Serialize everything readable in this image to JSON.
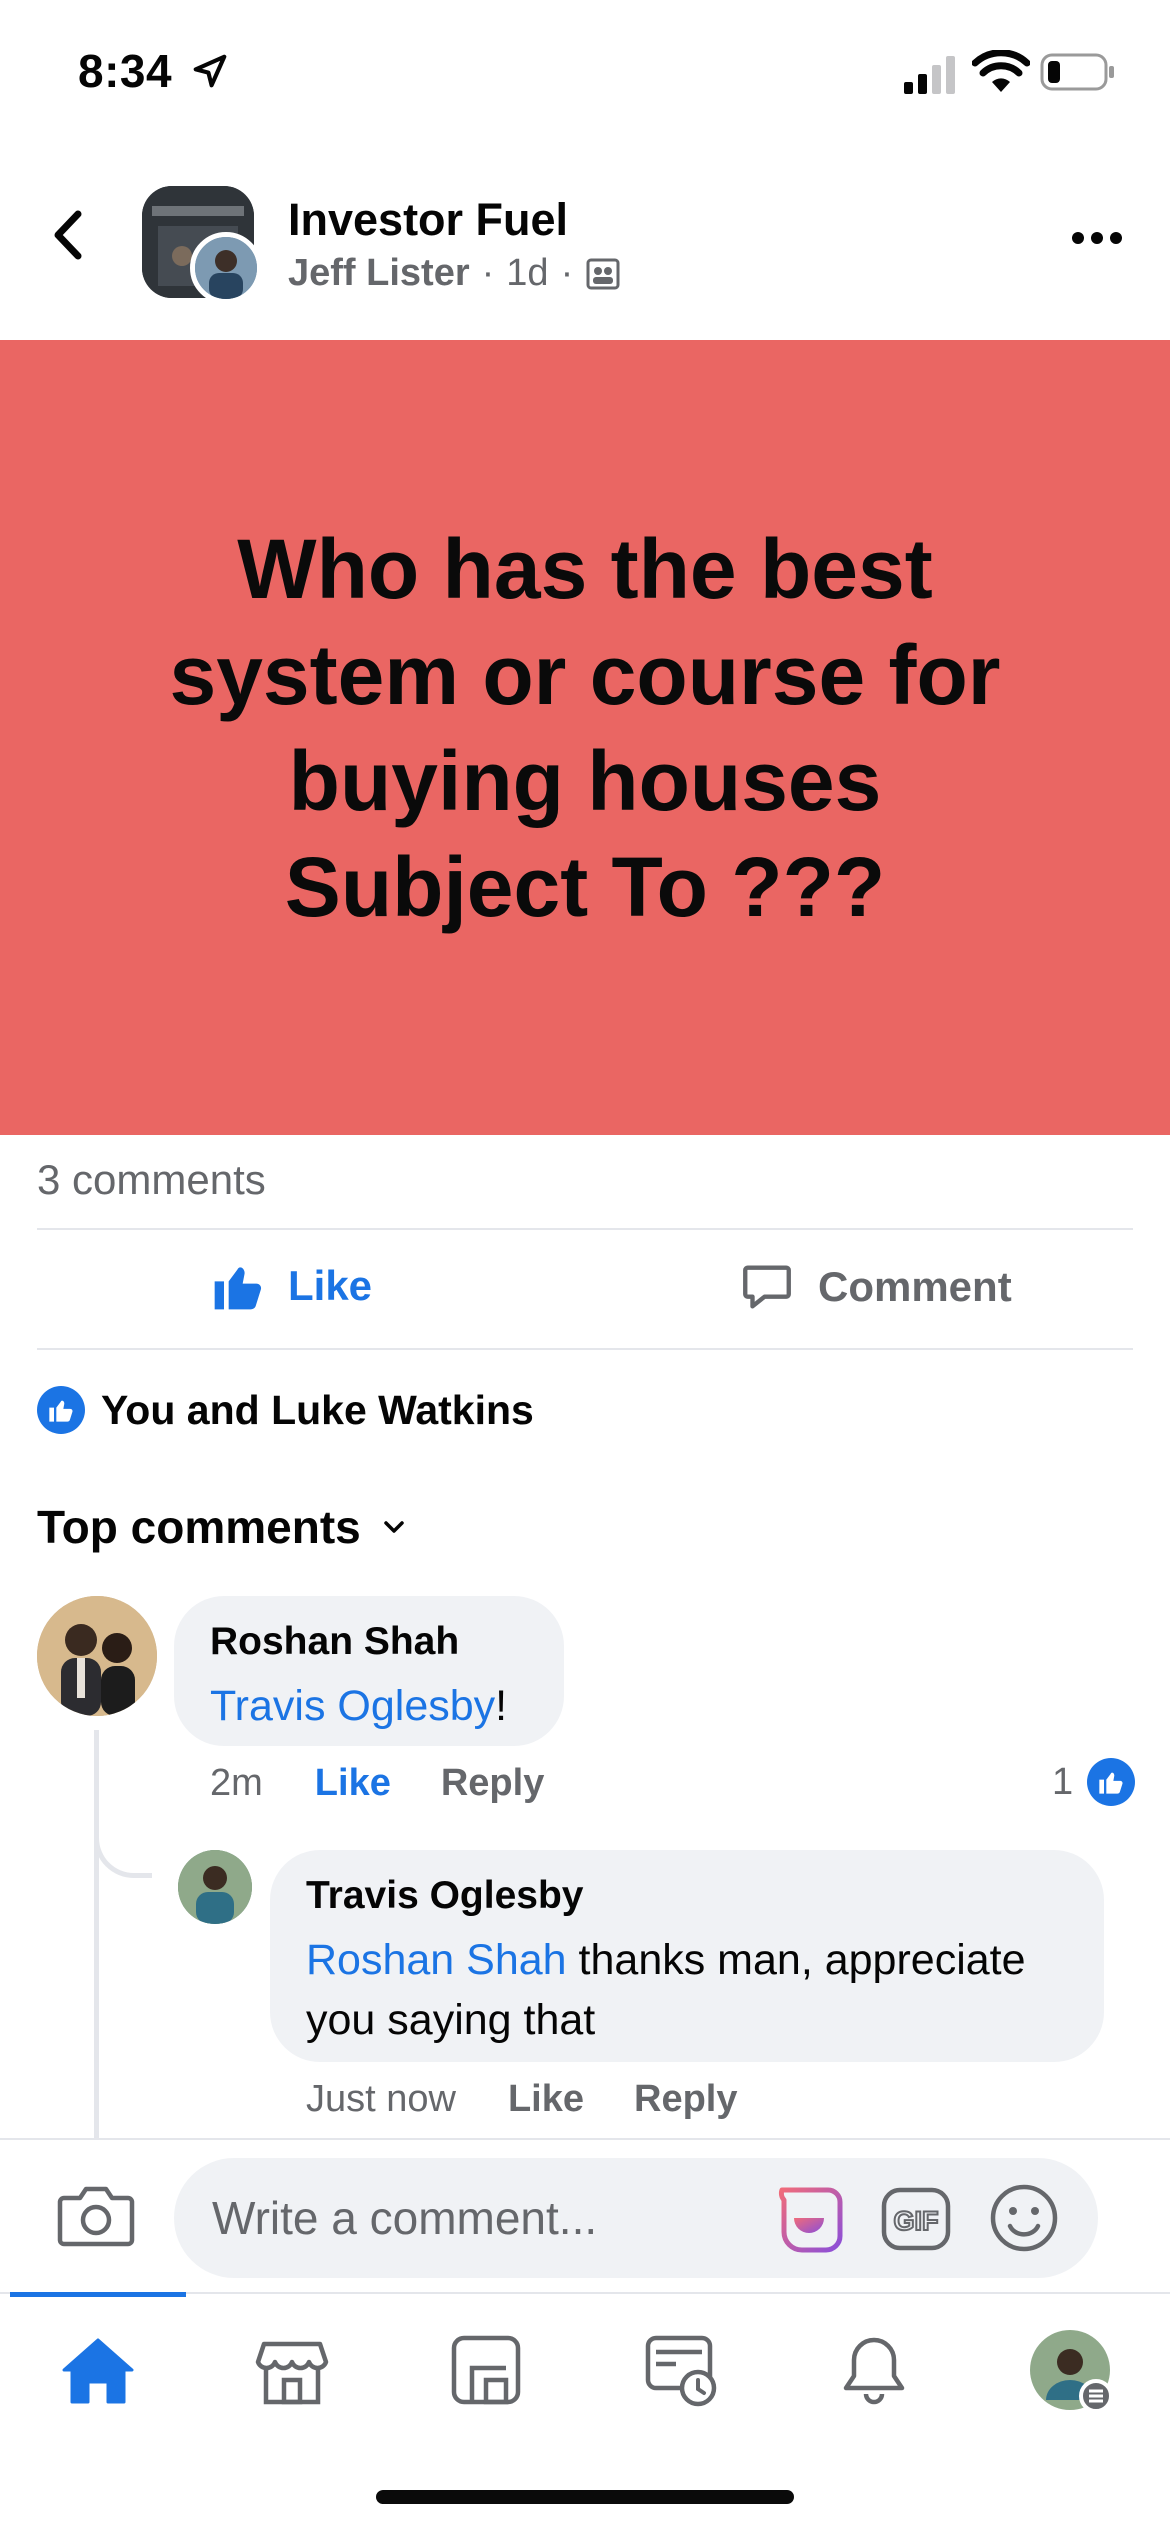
{
  "status_bar": {
    "time": "8:34"
  },
  "header": {
    "group_name": "Investor Fuel",
    "author": "Jeff Lister",
    "time_ago": "1d"
  },
  "post": {
    "text": "Who has the best\nsystem or course for\nbuying houses\nSubject To ???",
    "background_color": "#ea6663",
    "comment_count": "3 comments"
  },
  "actions": {
    "like_label": "Like",
    "comment_label": "Comment"
  },
  "reactions": {
    "summary": "You and Luke Watkins"
  },
  "comments_section": {
    "sort_label": "Top comments"
  },
  "comments": [
    {
      "author": "Roshan Shah",
      "mention": "Travis Oglesby",
      "text": "!",
      "time": "2m",
      "like_label": "Like",
      "reply_label": "Reply",
      "like_count": "1"
    },
    {
      "author": "Travis Oglesby",
      "mention": "Roshan Shah",
      "text": " thanks man, appreciate you saying that",
      "time": "Just now",
      "like_label": "Like",
      "reply_label": "Reply"
    }
  ],
  "composer": {
    "placeholder": "Write a comment..."
  },
  "tab_bar": {
    "items": [
      "home-icon",
      "marketplace-icon",
      "groups-icon",
      "watch-icon",
      "notifications-icon",
      "profile-menu"
    ],
    "active": "home-icon"
  },
  "colors": {
    "accent": "#1b74e4",
    "secondary_text": "#65676b",
    "bubble": "#f0f2f5"
  }
}
